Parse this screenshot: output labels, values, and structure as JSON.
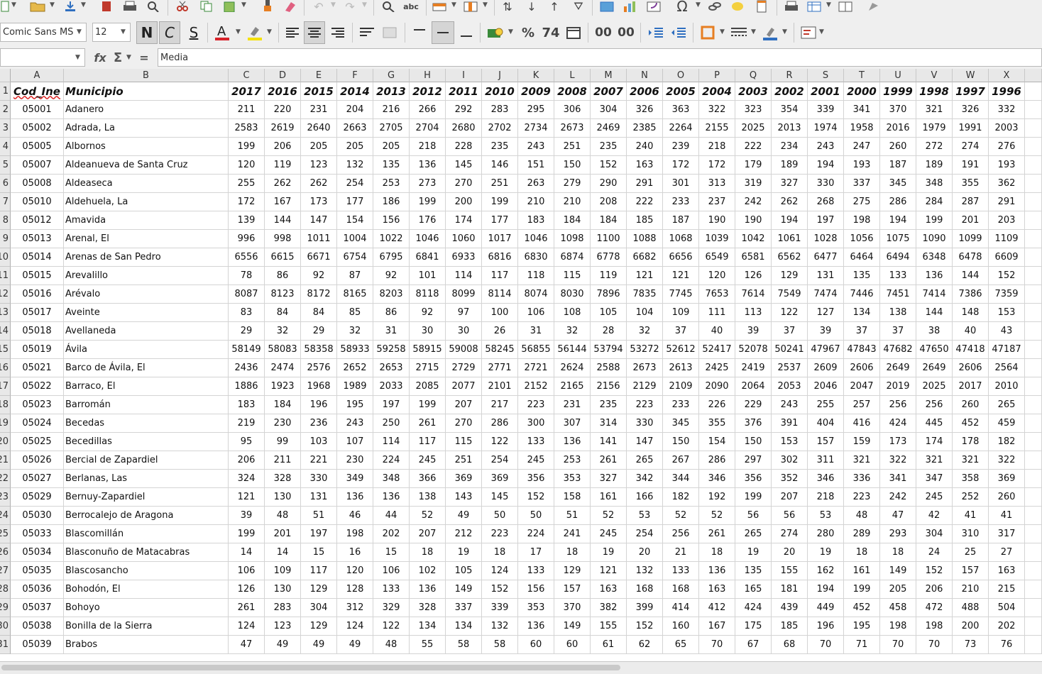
{
  "toolbar": {
    "font_name": "Comic Sans MS",
    "font_size": "12",
    "bold_label": "N",
    "italic_label": "C",
    "underline_label": "S",
    "percent_label": "%",
    "number_format_label": "74",
    "add_decimal_label": "00",
    "del_decimal_label": "00",
    "special_char_label": "Ω"
  },
  "formula_bar": {
    "name_box": "",
    "fx_label": "fx",
    "sum_label": "Σ",
    "equals_label": "=",
    "content": "Media"
  },
  "columns": [
    "A",
    "B",
    "C",
    "D",
    "E",
    "F",
    "G",
    "H",
    "I",
    "J",
    "K",
    "L",
    "M",
    "N",
    "O",
    "P",
    "Q",
    "R",
    "S",
    "T",
    "U",
    "V",
    "W",
    "X"
  ],
  "rows": [
    [
      "Cod_Ine",
      "Municipio",
      "2017",
      "2016",
      "2015",
      "2014",
      "2013",
      "2012",
      "2011",
      "2010",
      "2009",
      "2008",
      "2007",
      "2006",
      "2005",
      "2004",
      "2003",
      "2002",
      "2001",
      "2000",
      "1999",
      "1998",
      "1997",
      "1996"
    ],
    [
      "05001",
      "Adanero",
      "211",
      "220",
      "231",
      "204",
      "216",
      "266",
      "292",
      "283",
      "295",
      "306",
      "304",
      "326",
      "363",
      "322",
      "323",
      "354",
      "339",
      "341",
      "370",
      "321",
      "326",
      "332"
    ],
    [
      "05002",
      "Adrada, La",
      "2583",
      "2619",
      "2640",
      "2663",
      "2705",
      "2704",
      "2680",
      "2702",
      "2734",
      "2673",
      "2469",
      "2385",
      "2264",
      "2155",
      "2025",
      "2013",
      "1974",
      "1958",
      "2016",
      "1979",
      "1991",
      "2003"
    ],
    [
      "05005",
      "Albornos",
      "199",
      "206",
      "205",
      "205",
      "205",
      "218",
      "228",
      "235",
      "243",
      "251",
      "235",
      "240",
      "239",
      "218",
      "222",
      "234",
      "243",
      "247",
      "260",
      "272",
      "274",
      "276"
    ],
    [
      "05007",
      "Aldeanueva de Santa Cruz",
      "120",
      "119",
      "123",
      "132",
      "135",
      "136",
      "145",
      "146",
      "151",
      "150",
      "152",
      "163",
      "172",
      "172",
      "179",
      "189",
      "194",
      "193",
      "187",
      "189",
      "191",
      "193"
    ],
    [
      "05008",
      "Aldeaseca",
      "255",
      "262",
      "262",
      "254",
      "253",
      "273",
      "270",
      "251",
      "263",
      "279",
      "290",
      "291",
      "301",
      "313",
      "319",
      "327",
      "330",
      "337",
      "345",
      "348",
      "355",
      "362"
    ],
    [
      "05010",
      "Aldehuela, La",
      "172",
      "167",
      "173",
      "177",
      "186",
      "199",
      "200",
      "199",
      "210",
      "210",
      "208",
      "222",
      "233",
      "237",
      "242",
      "262",
      "268",
      "275",
      "286",
      "284",
      "287",
      "291"
    ],
    [
      "05012",
      "Amavida",
      "139",
      "144",
      "147",
      "154",
      "156",
      "176",
      "174",
      "177",
      "183",
      "184",
      "184",
      "185",
      "187",
      "190",
      "190",
      "194",
      "197",
      "198",
      "194",
      "199",
      "201",
      "203"
    ],
    [
      "05013",
      "Arenal, El",
      "996",
      "998",
      "1011",
      "1004",
      "1022",
      "1046",
      "1060",
      "1017",
      "1046",
      "1098",
      "1100",
      "1088",
      "1068",
      "1039",
      "1042",
      "1061",
      "1028",
      "1056",
      "1075",
      "1090",
      "1099",
      "1109"
    ],
    [
      "05014",
      "Arenas de San Pedro",
      "6556",
      "6615",
      "6671",
      "6754",
      "6795",
      "6841",
      "6933",
      "6816",
      "6830",
      "6874",
      "6778",
      "6682",
      "6656",
      "6549",
      "6581",
      "6562",
      "6477",
      "6464",
      "6494",
      "6348",
      "6478",
      "6609"
    ],
    [
      "05015",
      "Arevalillo",
      "78",
      "86",
      "92",
      "87",
      "92",
      "101",
      "114",
      "117",
      "118",
      "115",
      "119",
      "121",
      "121",
      "120",
      "126",
      "129",
      "131",
      "135",
      "133",
      "136",
      "144",
      "152"
    ],
    [
      "05016",
      "Arévalo",
      "8087",
      "8123",
      "8172",
      "8165",
      "8203",
      "8118",
      "8099",
      "8114",
      "8074",
      "8030",
      "7896",
      "7835",
      "7745",
      "7653",
      "7614",
      "7549",
      "7474",
      "7446",
      "7451",
      "7414",
      "7386",
      "7359"
    ],
    [
      "05017",
      "Aveinte",
      "83",
      "84",
      "84",
      "85",
      "86",
      "92",
      "97",
      "100",
      "106",
      "108",
      "105",
      "104",
      "109",
      "111",
      "113",
      "122",
      "127",
      "134",
      "138",
      "144",
      "148",
      "153"
    ],
    [
      "05018",
      "Avellaneda",
      "29",
      "32",
      "29",
      "32",
      "31",
      "30",
      "30",
      "26",
      "31",
      "32",
      "28",
      "32",
      "37",
      "40",
      "39",
      "37",
      "39",
      "37",
      "37",
      "38",
      "40",
      "43"
    ],
    [
      "05019",
      "Ávila",
      "58149",
      "58083",
      "58358",
      "58933",
      "59258",
      "58915",
      "59008",
      "58245",
      "56855",
      "56144",
      "53794",
      "53272",
      "52612",
      "52417",
      "52078",
      "50241",
      "47967",
      "47843",
      "47682",
      "47650",
      "47418",
      "47187"
    ],
    [
      "05021",
      "Barco de Ávila, El",
      "2436",
      "2474",
      "2576",
      "2652",
      "2653",
      "2715",
      "2729",
      "2771",
      "2721",
      "2624",
      "2588",
      "2673",
      "2613",
      "2425",
      "2419",
      "2537",
      "2609",
      "2606",
      "2649",
      "2649",
      "2606",
      "2564"
    ],
    [
      "05022",
      "Barraco, El",
      "1886",
      "1923",
      "1968",
      "1989",
      "2033",
      "2085",
      "2077",
      "2101",
      "2152",
      "2165",
      "2156",
      "2129",
      "2109",
      "2090",
      "2064",
      "2053",
      "2046",
      "2047",
      "2019",
      "2025",
      "2017",
      "2010"
    ],
    [
      "05023",
      "Barromán",
      "183",
      "184",
      "196",
      "195",
      "197",
      "199",
      "207",
      "217",
      "223",
      "231",
      "235",
      "223",
      "233",
      "226",
      "229",
      "243",
      "255",
      "257",
      "256",
      "256",
      "260",
      "265"
    ],
    [
      "05024",
      "Becedas",
      "219",
      "230",
      "236",
      "243",
      "250",
      "261",
      "270",
      "286",
      "300",
      "307",
      "314",
      "330",
      "345",
      "355",
      "376",
      "391",
      "404",
      "416",
      "424",
      "445",
      "452",
      "459"
    ],
    [
      "05025",
      "Becedillas",
      "95",
      "99",
      "103",
      "107",
      "114",
      "117",
      "115",
      "122",
      "133",
      "136",
      "141",
      "147",
      "150",
      "154",
      "150",
      "153",
      "157",
      "159",
      "173",
      "174",
      "178",
      "182"
    ],
    [
      "05026",
      "Bercial de Zapardiel",
      "206",
      "211",
      "221",
      "230",
      "224",
      "245",
      "251",
      "254",
      "245",
      "253",
      "261",
      "265",
      "267",
      "286",
      "297",
      "302",
      "311",
      "321",
      "322",
      "321",
      "321",
      "322"
    ],
    [
      "05027",
      "Berlanas, Las",
      "324",
      "328",
      "330",
      "349",
      "348",
      "366",
      "369",
      "369",
      "356",
      "353",
      "327",
      "342",
      "344",
      "346",
      "356",
      "352",
      "346",
      "336",
      "341",
      "347",
      "358",
      "369"
    ],
    [
      "05029",
      "Bernuy-Zapardiel",
      "121",
      "130",
      "131",
      "136",
      "136",
      "138",
      "143",
      "145",
      "152",
      "158",
      "161",
      "166",
      "182",
      "192",
      "199",
      "207",
      "218",
      "223",
      "242",
      "245",
      "252",
      "260"
    ],
    [
      "05030",
      "Berrocalejo de Aragona",
      "39",
      "48",
      "51",
      "46",
      "44",
      "52",
      "49",
      "50",
      "50",
      "51",
      "52",
      "53",
      "52",
      "52",
      "56",
      "56",
      "53",
      "48",
      "47",
      "42",
      "41",
      "41"
    ],
    [
      "05033",
      "Blascomillán",
      "199",
      "201",
      "197",
      "198",
      "202",
      "207",
      "212",
      "223",
      "224",
      "241",
      "245",
      "254",
      "256",
      "261",
      "265",
      "274",
      "280",
      "289",
      "293",
      "304",
      "310",
      "317"
    ],
    [
      "05034",
      "Blasconuño de Matacabras",
      "14",
      "14",
      "15",
      "16",
      "15",
      "18",
      "19",
      "18",
      "17",
      "18",
      "19",
      "20",
      "21",
      "18",
      "19",
      "20",
      "19",
      "18",
      "18",
      "24",
      "25",
      "27"
    ],
    [
      "05035",
      "Blascosancho",
      "106",
      "109",
      "117",
      "120",
      "106",
      "102",
      "105",
      "124",
      "133",
      "129",
      "121",
      "132",
      "133",
      "136",
      "135",
      "155",
      "162",
      "161",
      "149",
      "152",
      "157",
      "163"
    ],
    [
      "05036",
      "Bohodón, El",
      "126",
      "130",
      "129",
      "128",
      "133",
      "136",
      "149",
      "152",
      "156",
      "157",
      "163",
      "168",
      "168",
      "163",
      "165",
      "181",
      "194",
      "199",
      "205",
      "206",
      "210",
      "215"
    ],
    [
      "05037",
      "Bohoyo",
      "261",
      "283",
      "304",
      "312",
      "329",
      "328",
      "337",
      "339",
      "353",
      "370",
      "382",
      "399",
      "414",
      "412",
      "424",
      "439",
      "449",
      "452",
      "458",
      "472",
      "488",
      "504"
    ],
    [
      "05038",
      "Bonilla de la Sierra",
      "124",
      "123",
      "129",
      "124",
      "122",
      "134",
      "134",
      "132",
      "136",
      "149",
      "155",
      "152",
      "160",
      "167",
      "175",
      "185",
      "196",
      "195",
      "198",
      "198",
      "200",
      "202"
    ],
    [
      "05039",
      "Brabos",
      "47",
      "49",
      "49",
      "49",
      "48",
      "55",
      "58",
      "58",
      "60",
      "60",
      "61",
      "62",
      "65",
      "70",
      "67",
      "68",
      "70",
      "71",
      "70",
      "70",
      "73",
      "76"
    ]
  ],
  "row_numbers": [
    "1",
    "2",
    "3",
    "4",
    "5",
    "6",
    "7",
    "8",
    "9",
    "10",
    "11",
    "12",
    "13",
    "14",
    "15",
    "16",
    "17",
    "18",
    "19",
    "20",
    "21",
    "22",
    "23",
    "24",
    "25",
    "26",
    "27",
    "28",
    "29",
    "30",
    "31"
  ]
}
